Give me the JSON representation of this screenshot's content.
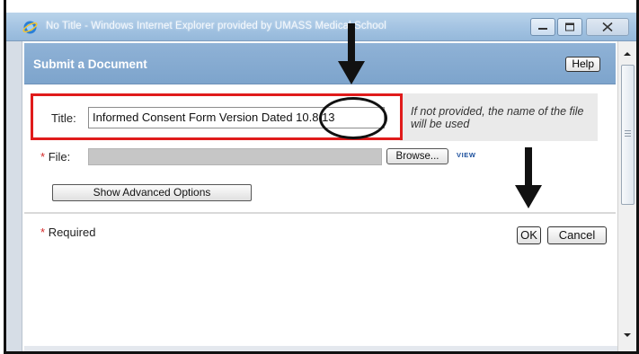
{
  "window": {
    "title": "No Title - Windows Internet Explorer provided by UMASS Medical School",
    "buttons": [
      "minimize",
      "maximize",
      "close"
    ]
  },
  "dialog": {
    "title": "Submit a Document",
    "help_label": "Help"
  },
  "form": {
    "title_label": "Title:",
    "title_value": "Informed Consent Form Version Dated 10.8.13",
    "title_note": "If not provided, the name of the file will be used",
    "file_required_mark": "*",
    "file_label": "File:",
    "browse_label": "Browse...",
    "view_label": "VIEW",
    "advanced_label": "Show Advanced Options",
    "required_mark": "*",
    "required_label": "Required",
    "ok_label": "OK",
    "cancel_label": "Cancel"
  },
  "annotations": {
    "highlight_color": "#e01b1b",
    "arrow_color": "#111111"
  },
  "icons": [
    "ie-logo-icon",
    "minimize-icon",
    "maximize-icon",
    "close-icon",
    "scroll-up-icon",
    "scroll-down-icon"
  ]
}
